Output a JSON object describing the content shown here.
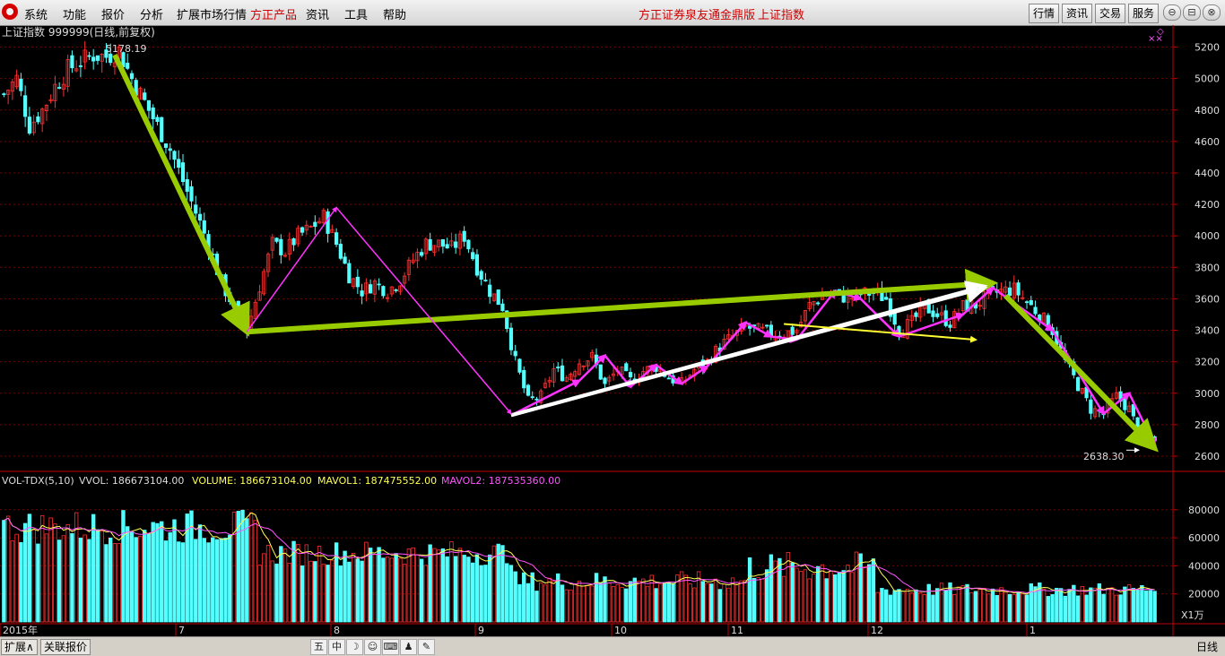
{
  "menu": [
    "系统",
    "功能",
    "报价",
    "分析",
    "扩展市场行情",
    "方正产品",
    "资讯",
    "工具",
    "帮助"
  ],
  "menu_red_index": 5,
  "center_title": [
    "方正证券泉友通金鼎版",
    "上证指数"
  ],
  "toolbar": [
    "行情",
    "资讯",
    "交易",
    "服务"
  ],
  "window_buttons": [
    "⊖",
    "⊟",
    "⊗"
  ],
  "chart_title": "上证指数 999999(日线,前复权)",
  "high_label": "5178.19",
  "low_label": "2638.30",
  "volume_header": {
    "name": "VOL-TDX(5,10)",
    "vvol": "VVOL: 186673104.00",
    "volume": "VOLUME: 186673104.00",
    "mavol1": "MAVOL1: 187475552.00",
    "mavol2": "MAVOL2: 187535360.00"
  },
  "colors": {
    "up": "#ff3030",
    "down": "#54ffff",
    "mavol1": "#ffff54",
    "mavol2": "#ff54ff",
    "grid": "#7a0000",
    "axis": "#c00000",
    "green_arrow": "#99cc00",
    "magenta_arrow": "#ff33ff",
    "yellow_arrow": "#ffff33",
    "white_arrow": "#ffffff"
  },
  "x_axis_labels": [
    "2015年",
    "7",
    "8",
    "9",
    "10",
    "11",
    "12",
    "1"
  ],
  "volume_unit": "X1万",
  "bottom_tabs": [
    "扩展∧",
    "关联报价"
  ],
  "bottom_icons": [
    "五",
    "中",
    "moon-icon",
    "smile-icon",
    "keyboard-icon",
    "person-icon",
    "wrench-icon"
  ],
  "period_label": "日线",
  "chart_data": {
    "type": "candlestick",
    "title": "上证指数 999999(日线,前复权)",
    "y_ticks": [
      2600,
      2800,
      3000,
      3200,
      3400,
      3600,
      3800,
      4000,
      4200,
      4400,
      4600,
      4800,
      5000,
      5200
    ],
    "ylim": [
      2560,
      5260
    ],
    "vol_ticks": [
      20000,
      40000,
      60000,
      80000
    ],
    "vol_ylim": [
      0,
      92000
    ],
    "close_path": [
      [
        0,
        4900
      ],
      [
        3,
        5000
      ],
      [
        6,
        4700
      ],
      [
        9,
        4800
      ],
      [
        12,
        4950
      ],
      [
        15,
        5060
      ],
      [
        18,
        5110
      ],
      [
        21,
        5150
      ],
      [
        24,
        5140
      ],
      [
        27,
        5178
      ],
      [
        30,
        5000
      ],
      [
        33,
        4850
      ],
      [
        36,
        4700
      ],
      [
        39,
        4550
      ],
      [
        42,
        4350
      ],
      [
        45,
        4150
      ],
      [
        48,
        3950
      ],
      [
        51,
        3700
      ],
      [
        54,
        3550
      ],
      [
        57,
        3400
      ],
      [
        60,
        3680
      ],
      [
        63,
        3950
      ],
      [
        66,
        3900
      ],
      [
        69,
        4000
      ],
      [
        72,
        4050
      ],
      [
        75,
        4120
      ],
      [
        78,
        3950
      ],
      [
        81,
        3750
      ],
      [
        84,
        3650
      ],
      [
        87,
        3700
      ],
      [
        90,
        3650
      ],
      [
        93,
        3720
      ],
      [
        96,
        3850
      ],
      [
        99,
        3950
      ],
      [
        102,
        3950
      ],
      [
        105,
        3920
      ],
      [
        108,
        4000
      ],
      [
        111,
        3800
      ],
      [
        114,
        3650
      ],
      [
        117,
        3550
      ],
      [
        120,
        3200
      ],
      [
        123,
        2950
      ],
      [
        126,
        2980
      ],
      [
        129,
        3150
      ],
      [
        132,
        3100
      ],
      [
        135,
        3200
      ],
      [
        138,
        3230
      ],
      [
        141,
        3050
      ],
      [
        144,
        3150
      ],
      [
        147,
        3080
      ],
      [
        150,
        3140
      ],
      [
        153,
        3170
      ],
      [
        156,
        3100
      ],
      [
        159,
        3060
      ],
      [
        162,
        3150
      ],
      [
        165,
        3200
      ],
      [
        168,
        3300
      ],
      [
        171,
        3360
      ],
      [
        174,
        3420
      ],
      [
        177,
        3400
      ],
      [
        180,
        3380
      ],
      [
        183,
        3380
      ],
      [
        186,
        3400
      ],
      [
        189,
        3560
      ],
      [
        192,
        3620
      ],
      [
        195,
        3640
      ],
      [
        198,
        3600
      ],
      [
        201,
        3630
      ],
      [
        204,
        3640
      ],
      [
        207,
        3600
      ],
      [
        210,
        3400
      ],
      [
        213,
        3450
      ],
      [
        216,
        3550
      ],
      [
        219,
        3500
      ],
      [
        222,
        3450
      ],
      [
        225,
        3550
      ],
      [
        228,
        3560
      ],
      [
        231,
        3620
      ],
      [
        234,
        3650
      ],
      [
        237,
        3660
      ],
      [
        240,
        3580
      ],
      [
        243,
        3500
      ],
      [
        246,
        3400
      ],
      [
        249,
        3200
      ],
      [
        252,
        3050
      ],
      [
        255,
        2900
      ],
      [
        258,
        2870
      ],
      [
        261,
        2980
      ],
      [
        264,
        2900
      ],
      [
        267,
        2700
      ],
      [
        270,
        2720
      ]
    ],
    "annotations": [
      {
        "color": "green",
        "from": [
          26,
          5150
        ],
        "to": [
          57,
          3390
        ]
      },
      {
        "color": "green",
        "from": [
          57,
          3390
        ],
        "to": [
          232,
          3700
        ]
      },
      {
        "color": "green",
        "from": [
          235,
          3620
        ],
        "to": [
          270,
          2650
        ]
      },
      {
        "color": "white",
        "from": [
          119,
          2860
        ],
        "to": [
          230,
          3680
        ]
      },
      {
        "color": "white",
        "from": [
          119,
          2860
        ],
        "to": [
          230,
          3670
        ]
      },
      {
        "color": "magenta",
        "from": [
          57,
          3390
        ],
        "to": [
          78,
          4180
        ]
      },
      {
        "color": "magenta",
        "from": [
          78,
          4180
        ],
        "to": [
          119,
          2870
        ]
      },
      {
        "color": "yellow",
        "from": [
          183,
          3440
        ],
        "to": [
          228,
          3340
        ]
      }
    ]
  }
}
